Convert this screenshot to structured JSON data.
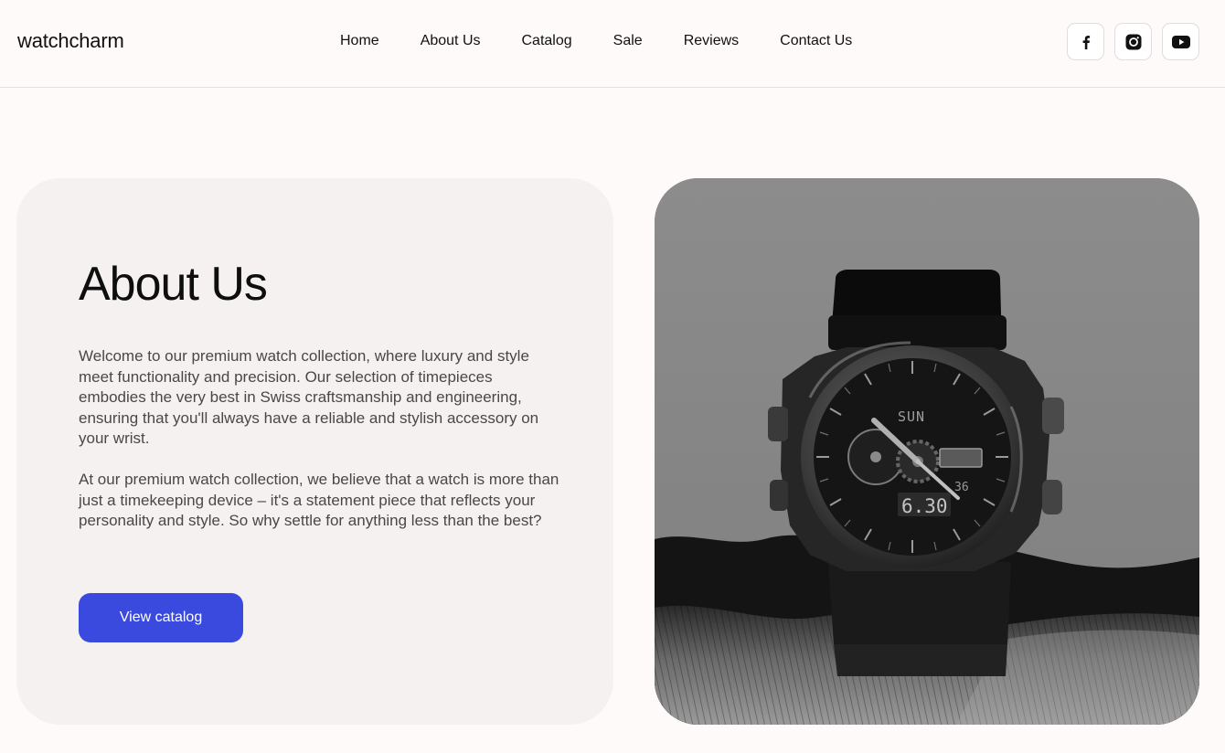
{
  "header": {
    "logo": "watchcharm",
    "nav": [
      "Home",
      "About Us",
      "Catalog",
      "Sale",
      "Reviews",
      "Contact Us"
    ],
    "socials": [
      "facebook-icon",
      "instagram-icon",
      "youtube-icon"
    ]
  },
  "about": {
    "title": "About Us",
    "paragraph_1": "Welcome to our premium watch collection, where luxury and style meet functionality and precision. Our selection of timepieces embodies the very best in Swiss craftsmanship and engineering, ensuring that you'll always have a reliable and stylish accessory on your wrist.",
    "paragraph_2": "At our premium watch collection, we believe that a watch is more than just a timekeeping device – it's a statement piece that reflects your personality and style. So why settle for anything less than the best?",
    "button_label": "View catalog"
  },
  "photo": {
    "dial_day": "SUN",
    "dial_time": "6.30",
    "dial_seconds": "36"
  },
  "colors": {
    "page_bg": "#fefafa",
    "card_bg": "#f5f1f1",
    "accent": "#3a4adf",
    "text": "#111111",
    "muted_text": "#4b4747"
  }
}
